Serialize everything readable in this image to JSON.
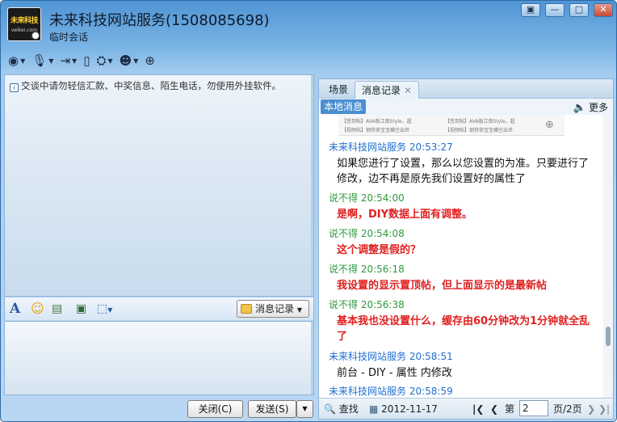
{
  "header": {
    "title": "未来科技网站服务(1508085698)",
    "subtitle": "临时会话",
    "avatar_logo": "未来科技",
    "avatar_sub": "veikei.com"
  },
  "window_buttons": {
    "skin": "▣",
    "minimize": "—",
    "maximize": "□",
    "close": "✕"
  },
  "toolbar": {
    "icons": [
      "video-icon",
      "mic-icon",
      "transfer-icon",
      "phone-icon",
      "share-icon",
      "remote-icon",
      "add-contact-icon"
    ]
  },
  "left": {
    "notice": "交谈中请勿轻信汇款、中奖信息、陌生电话，勿使用外挂软件。",
    "msg_record_label": "消息记录",
    "close_button": "关闭(C)",
    "send_button": "发送(S)"
  },
  "right": {
    "tabs": [
      "场景",
      "消息记录"
    ],
    "local_messages_label": "本地消息",
    "more_label": "更多",
    "thumb_lines": [
      "【签到帖】AVA版江南Style，超",
      "【签到帖】AVA版江南Style，超",
      "【视频帖】钢铁侠宝宝横空出世",
      "【视频帖】钢铁侠宝宝横空出世"
    ],
    "messages": [
      {
        "sender": "未来科技网站服务 20:53:27",
        "color": "blue",
        "text": "如果您进行了设置，那么以您设置的为准。只要进行了修改，边不再是原先我们设置好的属性了",
        "style": "normal"
      },
      {
        "sender": "说不得 20:54:00",
        "color": "green",
        "text": "是啊，DIY数据上面有调整。",
        "style": "red"
      },
      {
        "sender": "说不得 20:54:08",
        "color": "green",
        "text": "这个调整是假的？",
        "style": "red"
      },
      {
        "sender": "说不得 20:56:18",
        "color": "green",
        "text": "我设置的显示置顶帖，但上面显示的是最新帖",
        "style": "red"
      },
      {
        "sender": "说不得 20:56:38",
        "color": "green",
        "text": "基本我也没设置什么，缓存由60分钟改为1分钟就全乱了",
        "style": "red"
      },
      {
        "sender": "未来科技网站服务 20:58:51",
        "color": "blue",
        "text": "前台 - DIY - 属性 内修改",
        "style": "normal"
      },
      {
        "sender": "未来科技网站服务 20:58:59",
        "color": "blue",
        "text": "",
        "style": "normal"
      }
    ],
    "footer": {
      "find_label": "查找",
      "date": "2012-11-17",
      "page_prefix": "第",
      "page_value": "2",
      "page_suffix": "页/2页"
    }
  }
}
